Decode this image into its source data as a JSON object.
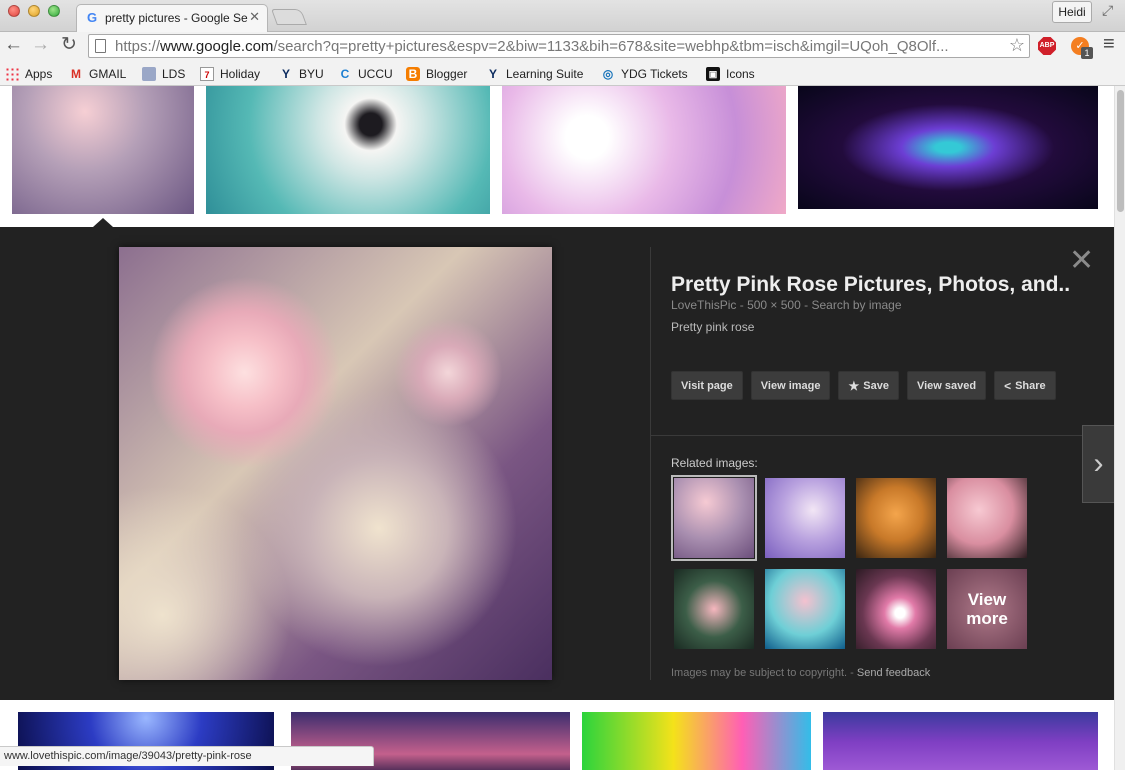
{
  "browser": {
    "tab_title": "pretty pictures - Google Se",
    "profile_name": "Heidi",
    "url_scheme": "https://",
    "url_host": "www.google.com",
    "url_path": "/search?q=pretty+pictures&espv=2&biw=1133&bih=678&site=webhp&tbm=isch&imgil=UQoh_Q8Olf...",
    "extension_badge": "1",
    "abp_label": "ABP",
    "status_url": "www.lovethispic.com/image/39043/pretty-pink-rose"
  },
  "bookmarks": [
    {
      "label": "Apps",
      "icon": "apps-grid-icon"
    },
    {
      "label": "GMAIL",
      "icon": "gmail-icon"
    },
    {
      "label": "LDS",
      "icon": "lds-icon"
    },
    {
      "label": "Holiday",
      "icon": "calendar-icon"
    },
    {
      "label": "BYU",
      "icon": "byu-icon"
    },
    {
      "label": "UCCU",
      "icon": "uccu-icon"
    },
    {
      "label": "Blogger",
      "icon": "blogger-icon"
    },
    {
      "label": "Learning Suite",
      "icon": "byu-icon"
    },
    {
      "label": "YDG Tickets",
      "icon": "ydg-icon"
    },
    {
      "label": "Icons",
      "icon": "icons-icon"
    }
  ],
  "viewer": {
    "title": "Pretty Pink Rose Pictures, Photos, and...",
    "source": "LoveThisPic",
    "dimensions": "500 × 500",
    "search_by_image": "Search by image",
    "separator": "-",
    "description": "Pretty pink rose",
    "actions": {
      "visit_page": "Visit page",
      "view_image": "View image",
      "save": "Save",
      "view_saved": "View saved",
      "share": "Share"
    },
    "related_label": "Related images:",
    "view_more_line1": "View",
    "view_more_line2": "more",
    "copyright_note": "Images may be subject to copyright.",
    "send_feedback": "Send feedback"
  },
  "colors": {
    "panel_bg": "#222222",
    "button_bg": "#3c3c3c",
    "tab_favicon": "#4285f4"
  }
}
